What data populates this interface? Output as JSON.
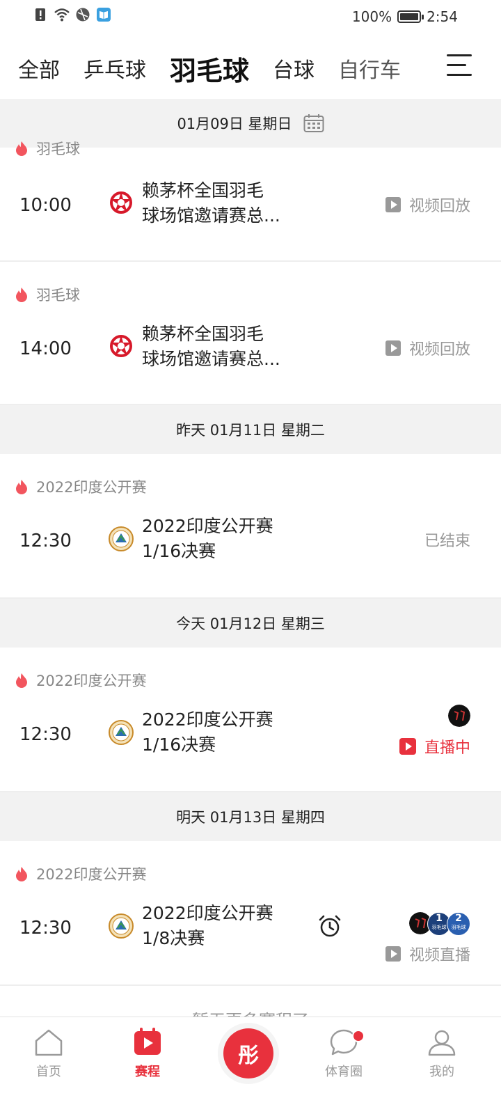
{
  "status_bar": {
    "battery_text": "100%",
    "battery_level": 1.0,
    "time": "2:54",
    "left_icons": [
      "alert-icon",
      "wifi-icon",
      "vpn-icon",
      "reader-app-icon"
    ]
  },
  "tabs": [
    {
      "label": "全部",
      "active": false
    },
    {
      "label": "乒乓球",
      "active": false
    },
    {
      "label": "羽毛球",
      "active": true
    },
    {
      "label": "台球",
      "active": false
    },
    {
      "label": "自行车",
      "active": false
    }
  ],
  "menu_icon": "menu-icon",
  "schedule": {
    "date_top": "01月09日 星期日",
    "partial_category": "羽毛球",
    "match1": {
      "time": "10:00",
      "title_l1": "赖茅杯全国羽毛",
      "title_l2": "球场馆邀请赛总...",
      "status": "视频回放"
    },
    "match2": {
      "category": "羽毛球",
      "time": "14:00",
      "title_l1": "赖茅杯全国羽毛",
      "title_l2": "球场馆邀请赛总...",
      "status": "视频回放"
    },
    "date_yesterday": "昨天 01月11日 星期二",
    "match3": {
      "category": "2022印度公开赛",
      "time": "12:30",
      "title_l1": "2022印度公开赛",
      "title_l2": "1/16决赛",
      "status": "已结束"
    },
    "date_today": "今天 01月12日 星期三",
    "match4": {
      "category": "2022印度公开赛",
      "time": "12:30",
      "title_l1": "2022印度公开赛",
      "title_l2": "1/16决赛",
      "status": "直播中"
    },
    "date_tomorrow": "明天 01月13日 星期四",
    "match5": {
      "category": "2022印度公开赛",
      "time": "12:30",
      "title_l1": "2022印度公开赛",
      "title_l2": "1/8决赛",
      "status": "视频直播",
      "channel_1": "1",
      "channel_2": "2",
      "channel_tag_1": "羽毛球",
      "channel_tag_2": "羽毛球"
    },
    "no_more": "暂无更多赛程了"
  },
  "bottom_nav": [
    {
      "label": "首页",
      "icon": "home-icon",
      "active": false
    },
    {
      "label": "赛程",
      "icon": "schedule-icon",
      "active": true
    },
    {
      "label": "体育圈",
      "icon": "chat-bubble-icon",
      "active": false,
      "badge": true
    },
    {
      "label": "我的",
      "icon": "profile-icon",
      "active": false
    }
  ],
  "center_button": "彤",
  "colors": {
    "accent": "#e8313d",
    "header_bg": "#f2f2f2",
    "muted_text": "#999999"
  }
}
